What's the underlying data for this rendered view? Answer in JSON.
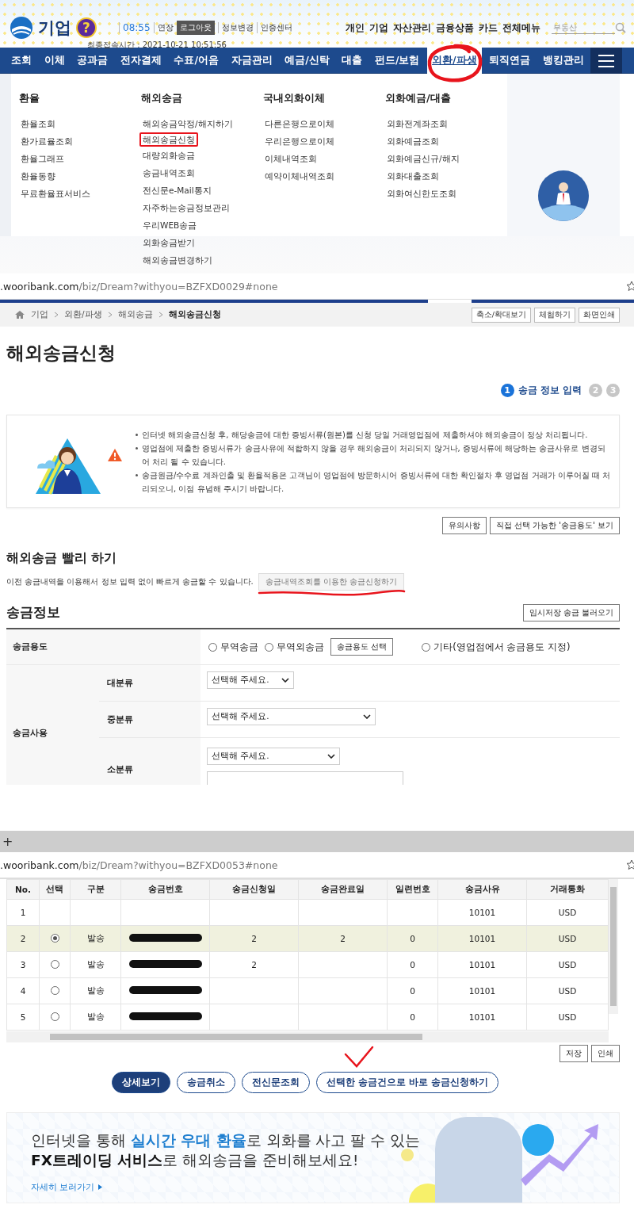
{
  "header": {
    "logo": "기업",
    "help": "?",
    "timer": "08:55",
    "extend": "연장",
    "logout": "로그아웃",
    "links": [
      "정보변경",
      "인증센터"
    ],
    "last_login": "최종접속시간 : 2021-10-21 10:51:56",
    "top_links": [
      "개인",
      "기업",
      "자산관리",
      "금융상품",
      "카드",
      "전체메뉴"
    ],
    "search": {
      "placeholder": "부동산"
    }
  },
  "nav": {
    "items": [
      {
        "label": "조회",
        "selected": false,
        "circled": false
      },
      {
        "label": "이체",
        "selected": false,
        "circled": false
      },
      {
        "label": "공과금",
        "selected": false,
        "circled": false
      },
      {
        "label": "전자결제",
        "selected": false,
        "circled": false
      },
      {
        "label": "수표/어음",
        "selected": false,
        "circled": false
      },
      {
        "label": "자금관리",
        "selected": false,
        "circled": false
      },
      {
        "label": "예금/신탁",
        "selected": false,
        "circled": false
      },
      {
        "label": "대출",
        "selected": false,
        "circled": false
      },
      {
        "label": "펀드/보험",
        "selected": false,
        "circled": false
      },
      {
        "label": "외환/파생",
        "selected": true,
        "circled": true
      },
      {
        "label": "퇴직연금",
        "selected": false,
        "circled": false
      },
      {
        "label": "뱅킹관리",
        "selected": false,
        "circled": false
      }
    ]
  },
  "mega_menu": {
    "columns": [
      {
        "title": "환율",
        "items": [
          {
            "label": "환율조회",
            "boxed": false
          },
          {
            "label": "환가료율조회",
            "boxed": false
          },
          {
            "label": "환율그래프",
            "boxed": false
          },
          {
            "label": "환율동향",
            "boxed": false
          },
          {
            "label": "무료환율표서비스",
            "boxed": false
          }
        ]
      },
      {
        "title": "해외송금",
        "items": [
          {
            "label": "해외송금약정/해지하기",
            "boxed": false
          },
          {
            "label": "해외송금신청",
            "boxed": true
          },
          {
            "label": "대량외화송금",
            "boxed": false
          },
          {
            "label": "송금내역조회",
            "boxed": false
          },
          {
            "label": "전신문e-Mail통지",
            "boxed": false
          },
          {
            "label": "자주하는송금정보관리",
            "boxed": false
          },
          {
            "label": "우리WEB송금",
            "boxed": false
          },
          {
            "label": "외화송금받기",
            "boxed": false
          },
          {
            "label": "해외송금변경하기",
            "boxed": false
          }
        ]
      },
      {
        "title": "국내외화이체",
        "items": [
          {
            "label": "다른은행으로이체",
            "boxed": false
          },
          {
            "label": "우리은행으로이체",
            "boxed": false
          },
          {
            "label": "이체내역조회",
            "boxed": false
          },
          {
            "label": "예약이체내역조회",
            "boxed": false
          }
        ]
      },
      {
        "title": "외화예금/대출",
        "items": [
          {
            "label": "외화전계좌조회",
            "boxed": false
          },
          {
            "label": "외화예금조회",
            "boxed": false
          },
          {
            "label": "외화예금신규/해지",
            "boxed": false
          },
          {
            "label": "외화대출조회",
            "boxed": false
          },
          {
            "label": "외화여신한도조회",
            "boxed": false
          }
        ]
      }
    ]
  },
  "apply_window": {
    "url_host": ".wooribank.com",
    "url_path": "/biz/Dream?withyou=BZFXD0029#none",
    "breadcrumb": [
      "기업",
      "외환/파생",
      "해외송금",
      "해외송금신청"
    ],
    "tools": [
      "축소/확대보기",
      "체험하기",
      "화면인쇄"
    ],
    "title": "해외송금신청",
    "steps": [
      {
        "number": "1",
        "label": "송금 정보 입력",
        "selected": true
      },
      {
        "number": "2",
        "selected": false
      },
      {
        "number": "3",
        "selected": false
      }
    ],
    "notices": [
      "인터넷 해외송금신청 후, 해당송금에 대한 증빙서류(원본)를 신청 당일 거래영업점에 제출하셔야 해외송금이 정상 처리됩니다.",
      "영업점에 제출한 증빙서류가 송금사유에 적합하지 않을 경우 해외송금이 처리되지 않거나, 증빙서류에 해당하는 송금사유로 변경되어 처리 될 수 있습니다.",
      "송금원금/수수료 계좌인출 및 환율적용은 고객님이 영업점에 방문하시어 증빙서류에 대한 확인절차 후 영업점 거래가 이루어질 때 처리되오니, 이점 유념해 주시기 바랍니다."
    ],
    "notice_buttons": [
      "유의사항",
      "직접 선택 가능한 '송금용도' 보기"
    ],
    "quick": {
      "title": "해외송금 빨리 하기",
      "description": "이전 송금내역을 이용해서 정보 입력 없이 빠르게 송금할 수 있습니다.",
      "button": "송금내역조회를 이용한 송금신청하기",
      "underlined": true
    },
    "remit_info": {
      "title": "송금정보",
      "load_button": "임시저장 송금 불러오기",
      "purpose": {
        "label": "송금용도",
        "fields": [
          {
            "kind": "radio",
            "label": "무역송금",
            "selected": false
          },
          {
            "kind": "radio",
            "label": "무역외송금",
            "selected": false
          },
          {
            "kind": "button",
            "label": "송금용도 선택"
          },
          {
            "kind": "radio",
            "label": "기타(영업점에서 송금용도 지정)",
            "selected": false
          }
        ]
      },
      "usage": {
        "label": "송금사용",
        "rows": [
          {
            "label": "대분류",
            "placeholder": "선택해 주세요.",
            "kind": "select"
          },
          {
            "label": "중분류",
            "placeholder": "선택해 주세요.",
            "kind": "select"
          },
          {
            "label": "소분류",
            "placeholder": "선택해 주세요.",
            "kind": "select_with_text"
          }
        ]
      }
    }
  },
  "history_window": {
    "new_tab": "+",
    "url_host": ".wooribank.com",
    "url_path": "/biz/Dream?withyou=BZFXD0053#none",
    "table": {
      "columns": [
        "No.",
        "선택",
        "구분",
        "송금번호",
        "송금신청일",
        "송금완료일",
        "일련번호",
        "송금사유",
        "거래통화"
      ],
      "rows": [
        {
          "kind": "obscured",
          "no": "1",
          "reason": "10101",
          "currency": "USD",
          "number_redacted": false
        },
        {
          "kind": "entry",
          "no": "2",
          "selected": true,
          "type": "발송",
          "requested": "2",
          "completed": "2",
          "serial": "0",
          "reason": "10101",
          "currency": "USD",
          "number_redacted": true
        },
        {
          "kind": "entry",
          "no": "3",
          "selected": false,
          "type": "발송",
          "requested": "2",
          "serial": "0",
          "reason": "10101",
          "currency": "USD",
          "number_redacted": true
        },
        {
          "kind": "entry",
          "no": "4",
          "selected": false,
          "type": "발송",
          "serial": "0",
          "reason": "10101",
          "currency": "USD",
          "number_redacted": true
        },
        {
          "kind": "entry",
          "no": "5",
          "selected": false,
          "type": "발송",
          "serial": "0",
          "reason": "10101",
          "currency": "USD",
          "number_redacted": true
        }
      ]
    },
    "file_buttons": [
      "저장",
      "인쇄"
    ],
    "actions": [
      {
        "label": "상세보기",
        "kind": "primary",
        "ticked": false
      },
      {
        "label": "송금취소",
        "kind": "outline",
        "ticked": false
      },
      {
        "label": "전신문조회",
        "kind": "outline",
        "ticked": false
      },
      {
        "label": "선택한 송금건으로 바로 송금신청하기",
        "kind": "outline",
        "ticked": true
      }
    ],
    "banner": {
      "lines": [
        "인터넷을 통해 **실시간 우대 환율**로 외화를 사고 팔 수 있는",
        "**FX트레이딩 서비스**로 해외송금을 준비해보세요!"
      ],
      "link": "자세히 보러가기"
    }
  }
}
